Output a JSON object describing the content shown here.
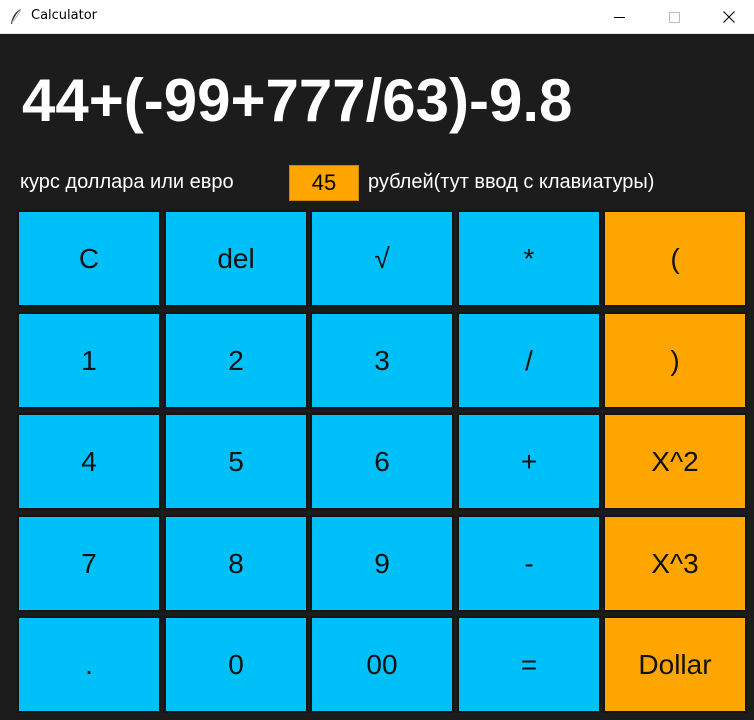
{
  "window": {
    "title": "Calculator",
    "icon": "feather-icon"
  },
  "display": {
    "expression": "44+(-99+777/63)-9.8"
  },
  "rate": {
    "label_left": "курс доллара или евро",
    "value": "45",
    "label_right": "рублей(тут ввод с клавиатуры)"
  },
  "colors": {
    "background": "#1c1c1c",
    "key_blue": "#00c0fa",
    "key_orange": "#ffa500"
  },
  "keys": [
    [
      "C",
      "del",
      "√",
      "*",
      "("
    ],
    [
      "1",
      "2",
      "3",
      "/",
      ")"
    ],
    [
      "4",
      "5",
      "6",
      "+",
      "X^2"
    ],
    [
      "7",
      "8",
      "9",
      "-",
      "X^3"
    ],
    [
      ".",
      "0",
      "00",
      "=",
      "Dollar"
    ]
  ]
}
